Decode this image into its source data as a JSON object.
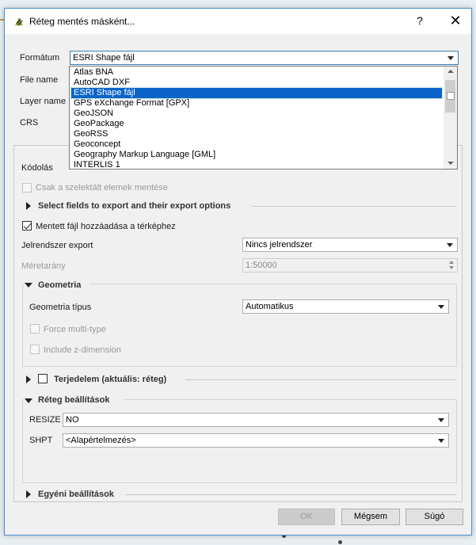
{
  "window": {
    "title": "Réteg mentés másként...",
    "help_glyph": "?",
    "close_glyph": "✕"
  },
  "form": {
    "format_label": "Formátum",
    "format_value": "ESRI Shape fájl",
    "file_name_label": "File name",
    "layer_name_label": "Layer name",
    "crs_label": "CRS"
  },
  "format_dropdown": {
    "options": [
      "Atlas BNA",
      "AutoCAD DXF",
      "ESRI Shape fájl",
      "GPS eXchange Format [GPX]",
      "GeoJSON",
      "GeoPackage",
      "GeoRSS",
      "Geoconcept",
      "Geography Markup Language [GML]",
      "INTERLIS 1"
    ],
    "selected_index": 2
  },
  "options_panel": {
    "encoding_label": "Kódolás",
    "selected_only_label": "Csak a szelektált elemek mentése",
    "select_fields_title": "Select fields to export and their export options",
    "add_to_map_label": "Mentett fájl hozzáadása a térképhez",
    "add_to_map_checked": true,
    "symbology_label": "Jelrendszer export",
    "symbology_value": "Nincs jelrendszer",
    "scale_label": "Méretarány",
    "scale_value": "1:50000"
  },
  "geometry": {
    "title": "Geometria",
    "type_label": "Geometria típus",
    "type_value": "Automatikus",
    "force_multi_label": "Force multi-type",
    "include_z_label": "Include z-dimension"
  },
  "extent": {
    "title": "Terjedelem (aktuális: réteg)"
  },
  "layer_settings": {
    "title": "Réteg beállítások",
    "rows": [
      {
        "label": "RESIZE",
        "value": "NO"
      },
      {
        "label": "SHPT",
        "value": "<Alapértelmezés>"
      }
    ]
  },
  "custom_settings": {
    "title": "Egyéni beállítások"
  },
  "buttons": {
    "ok": "OK",
    "cancel": "Mégsem",
    "help": "Súgó"
  },
  "colors": {
    "selection": "#0a64c8",
    "window_border": "#4a8fd6",
    "dialog_bg": "#f0f0f0"
  }
}
